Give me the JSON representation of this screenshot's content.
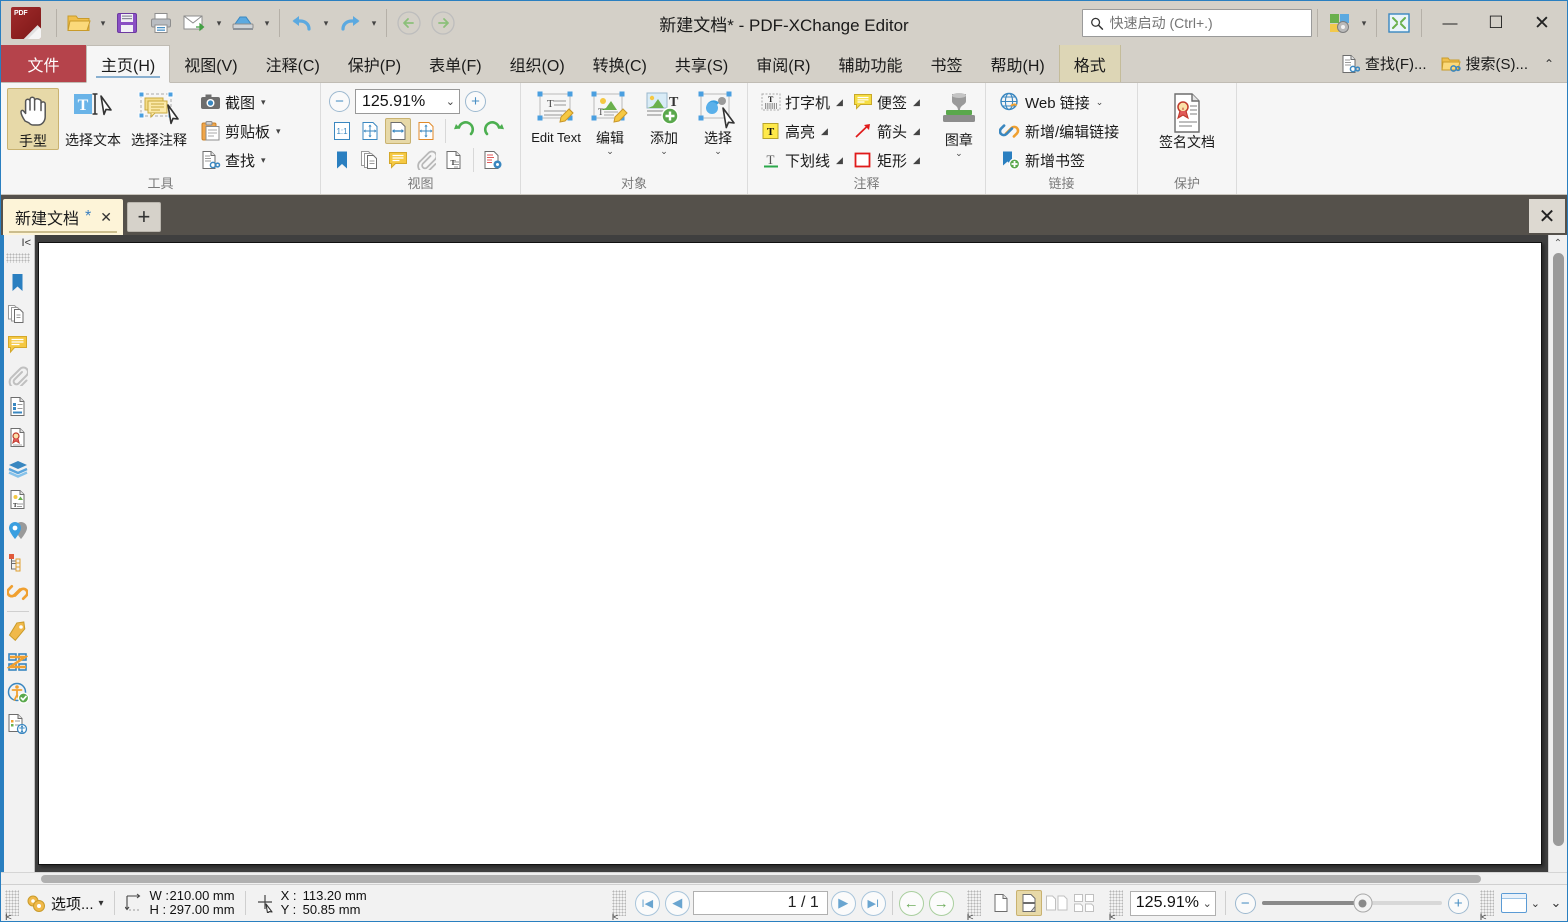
{
  "window": {
    "title": "新建文档* - PDF-XChange Editor",
    "app_name": "PDF-XChange Editor",
    "minimize_glyph": "—",
    "maximize_glyph": "☐",
    "close_glyph": "✕"
  },
  "quick_access": {
    "items": [
      {
        "name": "open-file",
        "icon": "folder-open-icon",
        "caret": true
      },
      {
        "name": "save",
        "icon": "save-floppy-icon",
        "caret": false
      },
      {
        "name": "print",
        "icon": "printer-icon",
        "caret": false
      },
      {
        "name": "email",
        "icon": "envelope-icon",
        "caret": true
      },
      {
        "name": "scan",
        "icon": "scanner-icon",
        "caret": true
      },
      {
        "name": "undo",
        "icon": "undo-arrow-icon",
        "caret": true
      },
      {
        "name": "redo",
        "icon": "redo-arrow-icon",
        "caret": true
      },
      {
        "name": "back",
        "icon": "back-arrow-icon",
        "caret": false
      },
      {
        "name": "forward",
        "icon": "forward-arrow-icon",
        "caret": false
      }
    ]
  },
  "quick_search": {
    "placeholder": "快速启动 (Ctrl+.)",
    "value": "",
    "icon": "search-icon"
  },
  "titlebar_extras": [
    {
      "name": "theme-settings",
      "icon": "theme-gear-icon",
      "caret": true
    },
    {
      "name": "fullscreen-toggle",
      "icon": "fullscreen-icon",
      "caret": false
    }
  ],
  "menubar": {
    "file_label": "文件",
    "tabs": [
      {
        "label": "主页(H)",
        "active": true
      },
      {
        "label": "视图(V)",
        "active": false
      },
      {
        "label": "注释(C)",
        "active": false
      },
      {
        "label": "保护(P)",
        "active": false
      },
      {
        "label": "表单(F)",
        "active": false
      },
      {
        "label": "组织(O)",
        "active": false
      },
      {
        "label": "转换(C)",
        "active": false
      },
      {
        "label": "共享(S)",
        "active": false
      },
      {
        "label": "审阅(R)",
        "active": false
      },
      {
        "label": "辅助功能",
        "active": false
      },
      {
        "label": "书签",
        "active": false
      },
      {
        "label": "帮助(H)",
        "active": false
      }
    ],
    "format_tab": "格式",
    "right_commands": [
      {
        "label": "查找(F)...",
        "icon": "find-document-icon"
      },
      {
        "label": "搜索(S)...",
        "icon": "search-folder-icon"
      }
    ],
    "collapse_glyph": "⌃"
  },
  "ribbon": {
    "groups": [
      {
        "name": "tools",
        "label": "工具",
        "big_buttons": [
          {
            "label": "手型",
            "icon": "hand-tool-icon",
            "active": true
          },
          {
            "label": "选择文本",
            "icon": "select-text-icon",
            "active": false
          },
          {
            "label": "选择注释",
            "icon": "select-comment-icon",
            "active": false
          }
        ],
        "small_buttons": [
          {
            "label": "截图",
            "icon": "camera-snapshot-icon",
            "caret": true
          },
          {
            "label": "剪贴板",
            "icon": "clipboard-icon",
            "caret": true
          },
          {
            "label": "查找",
            "icon": "find-document-icon",
            "caret": true
          }
        ]
      },
      {
        "name": "view",
        "label": "视图",
        "zoom_value": "125.91%",
        "zoom_out_glyph": "−",
        "zoom_in_glyph": "+",
        "icons_row1": [
          {
            "name": "actual-size",
            "icon": "one-to-one-icon",
            "active": false
          },
          {
            "name": "fit-page",
            "icon": "fit-page-icon",
            "active": false
          },
          {
            "name": "fit-width",
            "icon": "fit-width-icon",
            "active": true
          },
          {
            "name": "fit-visible",
            "icon": "fit-visible-icon",
            "active": false
          },
          {
            "name": "rotate-left",
            "icon": "rotate-ccw-icon",
            "active": false
          },
          {
            "name": "rotate-right",
            "icon": "rotate-cw-icon",
            "active": false
          }
        ],
        "icons_row2": [
          {
            "name": "bookmarks-pane",
            "icon": "bookmark-icon"
          },
          {
            "name": "pages-pane",
            "icon": "pages-thumbnail-icon"
          },
          {
            "name": "comments-pane",
            "icon": "comment-icon"
          },
          {
            "name": "attachments-pane",
            "icon": "paperclip-icon"
          },
          {
            "name": "content-pane",
            "icon": "content-text-icon"
          },
          {
            "name": "view-settings",
            "icon": "list-gear-icon"
          }
        ]
      },
      {
        "name": "objects",
        "label": "对象",
        "big_buttons": [
          {
            "label": "Edit Text",
            "icon": "edit-text-icon",
            "caret": false
          },
          {
            "label": "编辑",
            "icon": "edit-object-icon",
            "caret": true
          },
          {
            "label": "添加",
            "icon": "add-object-icon",
            "caret": true
          },
          {
            "label": "选择",
            "icon": "select-object-icon",
            "caret": true
          }
        ]
      },
      {
        "name": "comments",
        "label": "注释",
        "col1": [
          {
            "label": "打字机",
            "icon": "typewriter-icon",
            "caret": true
          },
          {
            "label": "高亮",
            "icon": "highlight-icon",
            "caret": true
          },
          {
            "label": "下划线",
            "icon": "underline-icon",
            "caret": true
          }
        ],
        "col2": [
          {
            "label": "便签",
            "icon": "sticky-note-icon",
            "caret": true
          },
          {
            "label": "箭头",
            "icon": "arrow-annotation-icon",
            "caret": true
          },
          {
            "label": "矩形",
            "icon": "rectangle-annotation-icon",
            "caret": true
          }
        ],
        "stamp": {
          "label": "图章",
          "icon": "stamp-icon",
          "caret": true
        }
      },
      {
        "name": "links",
        "label": "链接",
        "items": [
          {
            "label": "Web 链接",
            "icon": "globe-link-icon",
            "caret": true
          },
          {
            "label": "新增/编辑链接",
            "icon": "chain-link-icon",
            "caret": false
          },
          {
            "label": "新增书签",
            "icon": "add-bookmark-icon",
            "caret": false
          }
        ]
      },
      {
        "name": "protect",
        "label": "保护",
        "big_buttons": [
          {
            "label": "签名文档",
            "icon": "sign-document-icon"
          }
        ]
      }
    ]
  },
  "doc_tabs": {
    "tabs": [
      {
        "name": "新建文档",
        "modified_marker": "*",
        "close_glyph": "✕",
        "active": true
      }
    ],
    "new_tab_glyph": "+",
    "close_all_glyph": "✕"
  },
  "left_pane": {
    "collapse_glyph": "I<",
    "icons": [
      {
        "name": "bookmarks-pane",
        "icon": "bookmark-icon"
      },
      {
        "name": "pages-pane",
        "icon": "pages-thumbnail-icon"
      },
      {
        "name": "comments-pane",
        "icon": "comment-icon"
      },
      {
        "name": "attachments-pane",
        "icon": "paperclip-icon"
      },
      {
        "name": "content-pane",
        "icon": "content-list-icon"
      },
      {
        "name": "signatures-pane",
        "icon": "signature-certificate-icon"
      },
      {
        "name": "layers-pane",
        "icon": "layers-icon"
      },
      {
        "name": "fields-pane",
        "icon": "form-field-icon"
      },
      {
        "name": "destinations-pane",
        "icon": "destination-pin-icon"
      },
      {
        "name": "structure-pane",
        "icon": "tree-structure-icon"
      },
      {
        "name": "links-pane",
        "icon": "chain-link-icon"
      },
      {
        "name": "tags-pane",
        "icon": "tag-icon"
      },
      {
        "name": "order-pane",
        "icon": "order-z-icon"
      },
      {
        "name": "accessibility-check-pane",
        "icon": "accessibility-check-icon"
      },
      {
        "name": "reading-order-pane",
        "icon": "reading-order-icon"
      }
    ]
  },
  "statusbar": {
    "options_label": "选项...",
    "options_icon": "gear-options-icon",
    "page_size": {
      "icon": "page-size-icon",
      "width_label": "W :",
      "width_value": "210.00 mm",
      "height_label": "H :",
      "height_value": "297.00 mm"
    },
    "cursor_pos": {
      "icon": "crosshair-icon",
      "x_label": "X :",
      "x_value": "113.20 mm",
      "y_label": "Y :",
      "y_value": "50.85 mm"
    },
    "nav": {
      "first_glyph": "I◀",
      "prev_glyph": "◀",
      "page_value": "1 / 1",
      "next_glyph": "▶",
      "last_glyph": "▶I",
      "back_glyph": "←",
      "forward_glyph": "→"
    },
    "layout": [
      {
        "name": "single-page",
        "icon": "single-page-icon",
        "active": false
      },
      {
        "name": "continuous",
        "icon": "continuous-page-icon",
        "active": true
      },
      {
        "name": "two-page",
        "icon": "two-page-icon",
        "active": false
      },
      {
        "name": "two-page-continuous",
        "icon": "two-page-continuous-icon",
        "active": false
      }
    ],
    "zoom": {
      "value": "125.91%",
      "out_glyph": "−",
      "in_glyph": "+",
      "slider_percent": 56
    },
    "window_mode": {
      "name": "window-mode",
      "icon": "window-mini-icon",
      "caret": true
    },
    "collapse_glyph": "⌄"
  },
  "colors": {
    "accent_blue": "#2a7fc0",
    "file_tab_red": "#b5434b",
    "format_tab_tan": "#ddd6b6",
    "active_gold": "#e7d9a8",
    "doc_tab_cream": "#fdf4d8",
    "tabstrip_dark": "#55514b",
    "chrome_gray": "#d4d0c8"
  }
}
